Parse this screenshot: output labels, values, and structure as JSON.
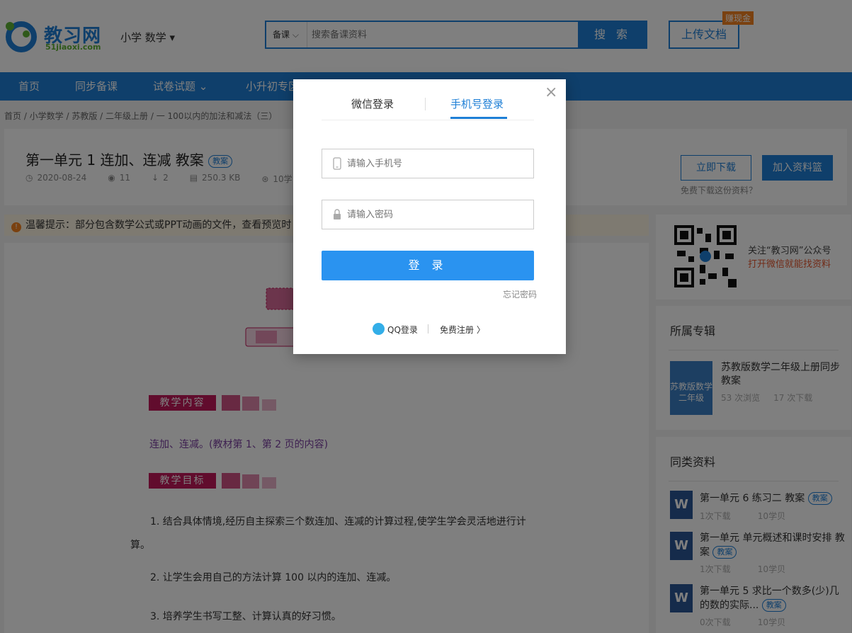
{
  "header": {
    "logo_name": "教习网",
    "logo_domain": "51jiaoxi.com",
    "grade_select": "小学 数学 ▾",
    "search": {
      "type": "备课",
      "placeholder": "搜索备课资料",
      "button": "搜 索"
    },
    "upload": "上传文档",
    "cash_badge": "赚现金"
  },
  "nav": {
    "items": [
      "首页",
      "同步备课",
      "试卷试题 ⌄",
      "小升初专区"
    ]
  },
  "breadcrumb": "首页 / 小学数学 / 苏教版 / 二年级上册 / 一 100以内的加法和减法（三）",
  "doc": {
    "title": "第一单元 1 连加、连减 教案",
    "tag": "教案",
    "date": "2020-08-24",
    "views": "11",
    "downloads": "2",
    "size": "250.3 KB",
    "price": "10学",
    "download_btn": "立即下载",
    "basket_btn": "加入资料篮",
    "free_question": "免费下载这份资料？"
  },
  "tip": {
    "text": "温馨提示：部分包含数学公式或PPT动画的文件，查看预览时"
  },
  "preview": {
    "section1": "教学内容",
    "content": "连加、连减。(教材第 1、第 2 页的内容)",
    "section2": "教学目标",
    "goal1a": "1. 结合具体情境,经历自主探索三个数连加、连减的计算过程,使学生学会灵活地进行计",
    "goal1b": "算。",
    "goal2": "2. 让学生会用自己的方法计算 100 以内的连加、连减。",
    "goal3": "3. 培养学生书写工整、计算认真的好习惯。"
  },
  "sidebar": {
    "follow1": "关注“教习网”公众号",
    "follow2": "打开微信就能找资料",
    "album": {
      "heading": "所属专辑",
      "cover_text": "苏教版数学二年级",
      "title": "苏教版数学二年级上册同步教案",
      "views": "53 次浏览",
      "downloads": "17 次下载"
    },
    "similar": {
      "heading": "同类资料",
      "items": [
        {
          "title": "第一单元 6 练习二 教案",
          "tag": "教案",
          "downloads": "1次下载",
          "price": "10学贝"
        },
        {
          "title": "第一单元 单元概述和课时安排 教案",
          "tag": "教案",
          "downloads": "1次下载",
          "price": "10学贝"
        },
        {
          "title": "第一单元 5 求比一个数多(少)几的数的实际...",
          "tag": "教案",
          "downloads": "0次下载",
          "price": "10学贝"
        }
      ]
    }
  },
  "modal": {
    "tab_wechat": "微信登录",
    "tab_phone": "手机号登录",
    "phone_placeholder": "请输入手机号",
    "password_placeholder": "请输入密码",
    "login_btn": "登 录",
    "forgot": "忘记密码",
    "qq_login": "QQ登录",
    "register": "免费注册 〉",
    "close": "×"
  },
  "colors": {
    "brand_blue": "#1e7fd6",
    "login_blue": "#2a93f0",
    "orange": "#f58220",
    "magenta": "#c2185b"
  }
}
